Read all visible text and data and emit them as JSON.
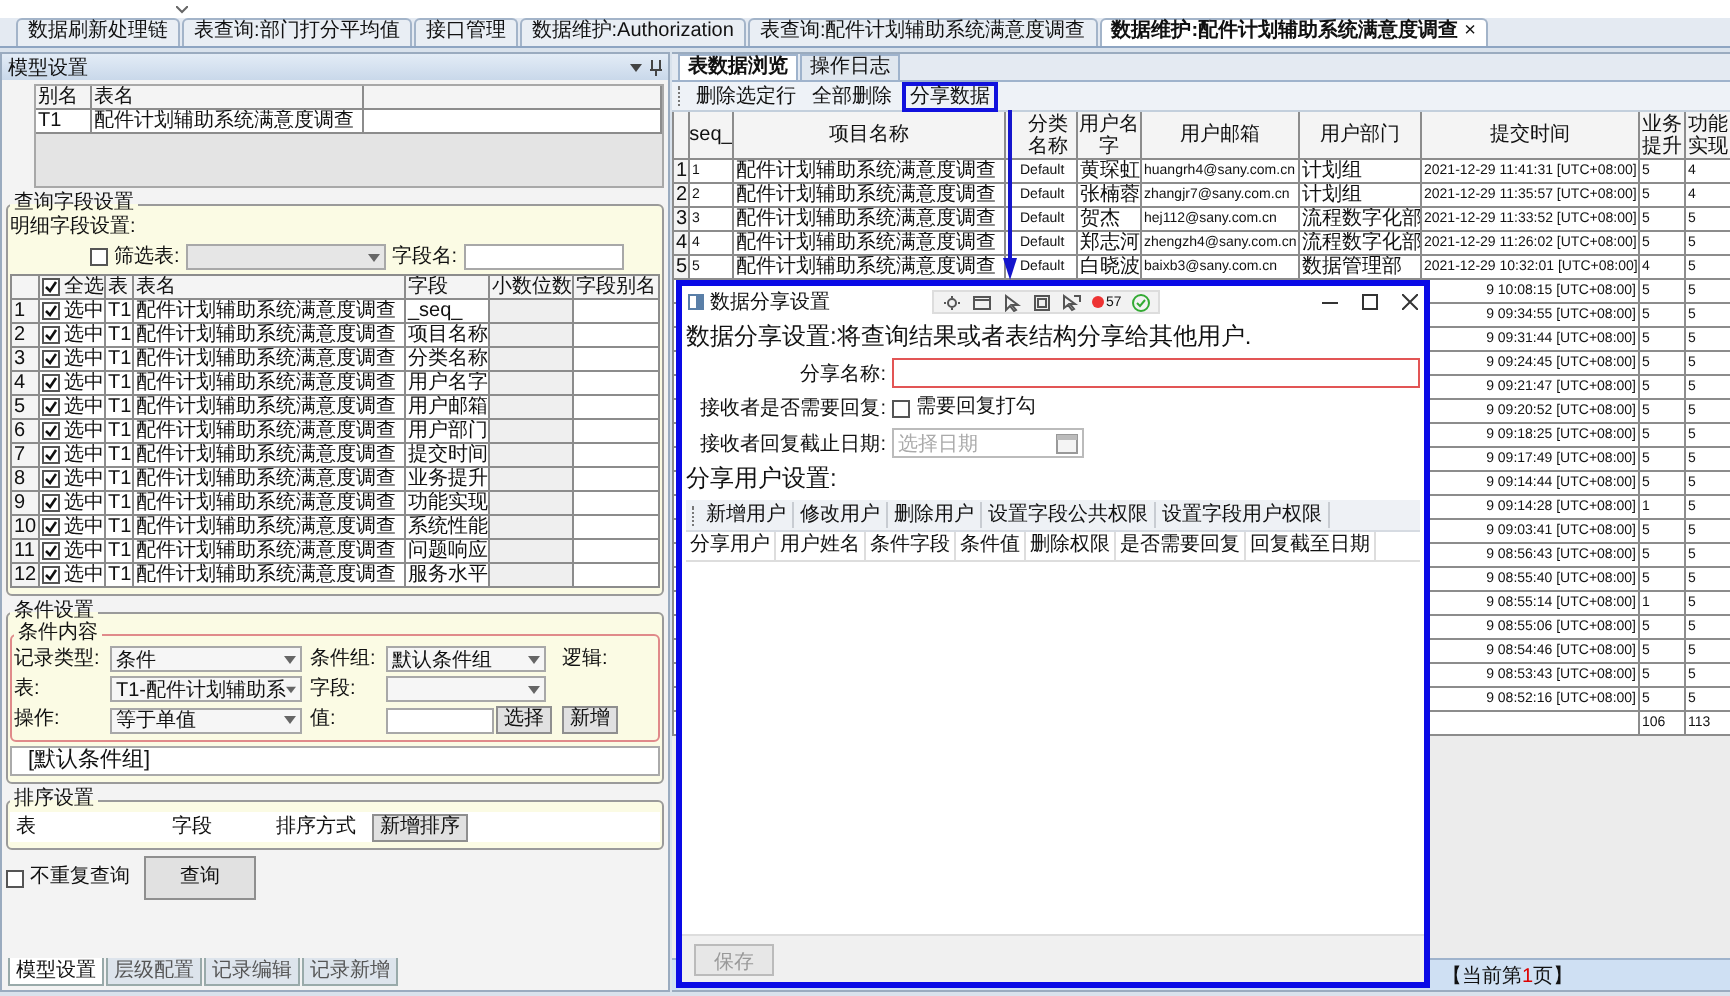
{
  "top_tabs": [
    {
      "label": "数据刷新处理链",
      "selected": false
    },
    {
      "label": "表查询:部门打分平均值",
      "selected": false
    },
    {
      "label": "接口管理",
      "selected": false
    },
    {
      "label": "数据维护:Authorization",
      "selected": false
    },
    {
      "label": "表查询:配件计划辅助系统满意度调查",
      "selected": false
    },
    {
      "label": "数据维护:配件计划辅助系统满意度调查",
      "selected": true,
      "close": "×"
    }
  ],
  "left_panel": {
    "title": "模型设置",
    "alias_table": {
      "columns": [
        "别名",
        "表名"
      ],
      "rows": [
        [
          "T1",
          "配件计划辅助系统满意度调查"
        ]
      ]
    },
    "query_fields": {
      "title": "查询字段设置",
      "detail_label": "明细字段设置:",
      "filter_label": "筛选表:",
      "filter_checked": false,
      "field_name_label": "字段名:",
      "select_all_label": "全选",
      "select_all_checked": true,
      "columns": [
        "表",
        "表名",
        "字段",
        "小数位数",
        "字段别名"
      ],
      "rows": [
        {
          "num": "1",
          "checked": true,
          "check_label": "选中",
          "table": "T1",
          "table_name": "配件计划辅助系统满意度调查",
          "field": "_seq_"
        },
        {
          "num": "2",
          "checked": true,
          "check_label": "选中",
          "table": "T1",
          "table_name": "配件计划辅助系统满意度调查",
          "field": "项目名称"
        },
        {
          "num": "3",
          "checked": true,
          "check_label": "选中",
          "table": "T1",
          "table_name": "配件计划辅助系统满意度调查",
          "field": "分类名称"
        },
        {
          "num": "4",
          "checked": true,
          "check_label": "选中",
          "table": "T1",
          "table_name": "配件计划辅助系统满意度调查",
          "field": "用户名字"
        },
        {
          "num": "5",
          "checked": true,
          "check_label": "选中",
          "table": "T1",
          "table_name": "配件计划辅助系统满意度调查",
          "field": "用户邮箱"
        },
        {
          "num": "6",
          "checked": true,
          "check_label": "选中",
          "table": "T1",
          "table_name": "配件计划辅助系统满意度调查",
          "field": "用户部门"
        },
        {
          "num": "7",
          "checked": true,
          "check_label": "选中",
          "table": "T1",
          "table_name": "配件计划辅助系统满意度调查",
          "field": "提交时间"
        },
        {
          "num": "8",
          "checked": true,
          "check_label": "选中",
          "table": "T1",
          "table_name": "配件计划辅助系统满意度调查",
          "field": "业务提升"
        },
        {
          "num": "9",
          "checked": true,
          "check_label": "选中",
          "table": "T1",
          "table_name": "配件计划辅助系统满意度调查",
          "field": "功能实现"
        },
        {
          "num": "10",
          "checked": true,
          "check_label": "选中",
          "table": "T1",
          "table_name": "配件计划辅助系统满意度调查",
          "field": "系统性能"
        },
        {
          "num": "11",
          "checked": true,
          "check_label": "选中",
          "table": "T1",
          "table_name": "配件计划辅助系统满意度调查",
          "field": "问题响应"
        },
        {
          "num": "12",
          "checked": true,
          "check_label": "选中",
          "table": "T1",
          "table_name": "配件计划辅助系统满意度调查",
          "field": "服务水平"
        }
      ]
    },
    "conditions": {
      "title": "条件设置",
      "content_title": "条件内容",
      "record_type_label": "记录类型:",
      "record_type": "条件",
      "group_label": "条件组:",
      "group": "默认条件组",
      "logic_label": "逻辑:",
      "table_label": "表:",
      "table": "T1-配件计划辅助系",
      "field_label": "字段:",
      "operator_label": "操作:",
      "operator": "等于单值",
      "value_label": "值:",
      "pick_button": "选择",
      "add_button": "新增",
      "groups": [
        "[默认条件组]"
      ]
    },
    "sort": {
      "title": "排序设置",
      "columns": [
        "表",
        "字段",
        "排序方式"
      ],
      "add_button": "新增排序"
    },
    "distinct": {
      "label": "不重复查询",
      "checked": false
    },
    "query_button": "查询",
    "bottom_tabs": [
      {
        "label": "模型设置",
        "selected": true
      },
      {
        "label": "层级配置",
        "selected": false
      },
      {
        "label": "记录编辑",
        "selected": false
      },
      {
        "label": "记录新增",
        "selected": false
      }
    ]
  },
  "right_panel": {
    "tabs": [
      {
        "label": "表数据浏览",
        "selected": true
      },
      {
        "label": "操作日志",
        "selected": false
      }
    ],
    "toolbar": [
      {
        "label": "删除选定行",
        "highlighted": false
      },
      {
        "label": "全部删除",
        "highlighted": false
      },
      {
        "label": "分享数据",
        "highlighted": true
      }
    ],
    "table": {
      "columns": [
        "seq_",
        "项目名称",
        "分类名称",
        "用户名字",
        "用户邮箱",
        "用户部门",
        "提交时间",
        "业务提升",
        "功能实现"
      ],
      "rows": [
        {
          "kind": "full",
          "num": "1",
          "cells": [
            "1",
            "配件计划辅助系统满意度调查",
            "Default",
            "黄琛虹",
            "huangrh4@sany.com.cn",
            "计划组",
            "2021-12-29 11:41:31 [UTC+08:00]",
            "5",
            "4"
          ]
        },
        {
          "kind": "full",
          "num": "2",
          "cells": [
            "2",
            "配件计划辅助系统满意度调查",
            "Default",
            "张楠蓉",
            "zhangjr7@sany.com.cn",
            "计划组",
            "2021-12-29 11:35:57 [UTC+08:00]",
            "5",
            "4"
          ]
        },
        {
          "kind": "full",
          "num": "3",
          "cells": [
            "3",
            "配件计划辅助系统满意度调查",
            "Default",
            "贺杰",
            "hej112@sany.com.cn",
            "流程数字化部",
            "2021-12-29 11:33:52 [UTC+08:00]",
            "5",
            "5"
          ]
        },
        {
          "kind": "full",
          "num": "4",
          "cells": [
            "4",
            "配件计划辅助系统满意度调查",
            "Default",
            "郑志河",
            "zhengzh4@sany.com.cn",
            "流程数字化部",
            "2021-12-29 11:26:02 [UTC+08:00]",
            "5",
            "5"
          ]
        },
        {
          "kind": "full",
          "num": "5",
          "cells": [
            "5",
            "配件计划辅助系统满意度调查",
            "Default",
            "白晓波",
            "baixb3@sany.com.cn",
            "数据管理部",
            "2021-12-29 10:32:01 [UTC+08:00]",
            "4",
            "5"
          ]
        },
        {
          "kind": "partial",
          "cells": [
            "9 10:08:15 [UTC+08:00]",
            "5",
            "5"
          ]
        },
        {
          "kind": "partial",
          "cells": [
            "9 09:34:55 [UTC+08:00]",
            "5",
            "5"
          ]
        },
        {
          "kind": "partial",
          "cells": [
            "9 09:31:44 [UTC+08:00]",
            "5",
            "5"
          ]
        },
        {
          "kind": "partial",
          "cells": [
            "9 09:24:45 [UTC+08:00]",
            "5",
            "5"
          ]
        },
        {
          "kind": "partial",
          "cells": [
            "9 09:21:47 [UTC+08:00]",
            "5",
            "5"
          ]
        },
        {
          "kind": "partial",
          "cells": [
            "9 09:20:52 [UTC+08:00]",
            "5",
            "5"
          ]
        },
        {
          "kind": "partial",
          "cells": [
            "9 09:18:25 [UTC+08:00]",
            "5",
            "5"
          ]
        },
        {
          "kind": "partial",
          "cells": [
            "9 09:17:49 [UTC+08:00]",
            "5",
            "5"
          ]
        },
        {
          "kind": "partial",
          "cells": [
            "9 09:14:44 [UTC+08:00]",
            "5",
            "5"
          ]
        },
        {
          "kind": "partial",
          "cells": [
            "9 09:14:28 [UTC+08:00]",
            "1",
            "5"
          ]
        },
        {
          "kind": "partial",
          "cells": [
            "9 09:03:41 [UTC+08:00]",
            "5",
            "5"
          ]
        },
        {
          "kind": "partial",
          "cells": [
            "9 08:56:43 [UTC+08:00]",
            "5",
            "5"
          ]
        },
        {
          "kind": "partial",
          "cells": [
            "9 08:55:40 [UTC+08:00]",
            "5",
            "5"
          ]
        },
        {
          "kind": "partial",
          "cells": [
            "9 08:55:14 [UTC+08:00]",
            "1",
            "5"
          ]
        },
        {
          "kind": "partial",
          "cells": [
            "9 08:55:06 [UTC+08:00]",
            "5",
            "5"
          ]
        },
        {
          "kind": "partial",
          "cells": [
            "9 08:54:46 [UTC+08:00]",
            "5",
            "5"
          ]
        },
        {
          "kind": "partial",
          "cells": [
            "9 08:53:43 [UTC+08:00]",
            "5",
            "5"
          ]
        },
        {
          "kind": "partial",
          "cells": [
            "9 08:52:16 [UTC+08:00]",
            "5",
            "5"
          ]
        }
      ],
      "totals": [
        "106",
        "113"
      ]
    },
    "pager": {
      "before": "【当前第",
      "page": "1",
      "after": "页】"
    }
  },
  "dialog": {
    "title": "数据分享设置",
    "highlighted": true,
    "badge": "57",
    "heading": "数据分享设置:将查询结果或者表结构分享给其他用户.",
    "fields": [
      {
        "kind": "text",
        "label": "分享名称:",
        "required": true
      },
      {
        "kind": "checkbox",
        "label": "接收者是否需要回复:",
        "option": "需要回复打勾",
        "checked": false
      },
      {
        "kind": "date",
        "label": "接收者回复截止日期:",
        "placeholder": "选择日期"
      }
    ],
    "users_title": "分享用户设置:",
    "toolbar": [
      "新增用户",
      "修改用户",
      "删除用户",
      "设置字段公共权限",
      "设置字段用户权限"
    ],
    "columns": [
      "分享用户",
      "用户姓名",
      "条件字段",
      "条件值",
      "删除权限",
      "是否需要回复",
      "回复截至日期"
    ],
    "save_button": {
      "label": "保存",
      "disabled": true
    }
  }
}
